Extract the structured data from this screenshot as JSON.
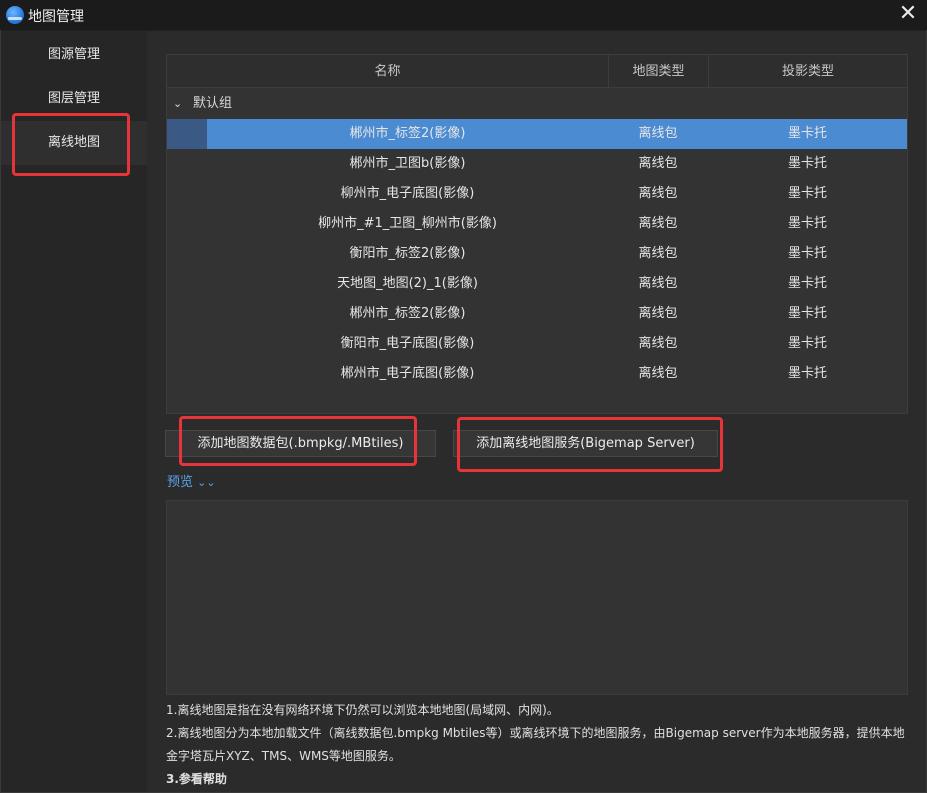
{
  "window": {
    "title": "地图管理",
    "close_symbol": "✕"
  },
  "sidebar": {
    "items": [
      {
        "label": "图源管理"
      },
      {
        "label": "图层管理"
      },
      {
        "label": "离线地图"
      }
    ],
    "active_index": 2
  },
  "table": {
    "headers": [
      "名称",
      "地图类型",
      "投影类型"
    ],
    "group": {
      "label": "默认组",
      "chevron": "⌄"
    },
    "rows": [
      {
        "name": "郴州市_标签2(影像)",
        "map_type": "离线包",
        "projection": "墨卡托",
        "selected": true
      },
      {
        "name": "郴州市_卫图b(影像)",
        "map_type": "离线包",
        "projection": "墨卡托"
      },
      {
        "name": "柳州市_电子底图(影像)",
        "map_type": "离线包",
        "projection": "墨卡托"
      },
      {
        "name": "柳州市_#1_卫图_柳州市(影像)",
        "map_type": "离线包",
        "projection": "墨卡托"
      },
      {
        "name": "衡阳市_标签2(影像)",
        "map_type": "离线包",
        "projection": "墨卡托"
      },
      {
        "name": "天地图_地图(2)_1(影像)",
        "map_type": "离线包",
        "projection": "墨卡托"
      },
      {
        "name": "郴州市_标签2(影像)",
        "map_type": "离线包",
        "projection": "墨卡托"
      },
      {
        "name": "衡阳市_电子底图(影像)",
        "map_type": "离线包",
        "projection": "墨卡托"
      },
      {
        "name": "郴州市_电子底图(影像)",
        "map_type": "离线包",
        "projection": "墨卡托"
      }
    ]
  },
  "buttons": {
    "add_package": "添加地图数据包(.bmpkg/.MBtiles)",
    "add_service": "添加离线地图服务(Bigemap Server)"
  },
  "preview": {
    "label": "预览",
    "chevron": "⌄⌄"
  },
  "notes": {
    "line1": "1.离线地图是指在没有网络环境下仍然可以浏览本地地图(局域网、内网)。",
    "line2a": "2.离线地图分为本地加载文件（离线数据包.bmpkg Mbtiles等）或离线环境下的地图服务，由Bigemap server作为本地服务器，提供本地",
    "line2b": "金字塔瓦片XYZ、TMS、WMS等地图服务。",
    "line3": "3.参看帮助"
  },
  "colors": {
    "highlight": "#e5343a",
    "selection": "#4a8bd2",
    "link": "#5aa2ea"
  }
}
